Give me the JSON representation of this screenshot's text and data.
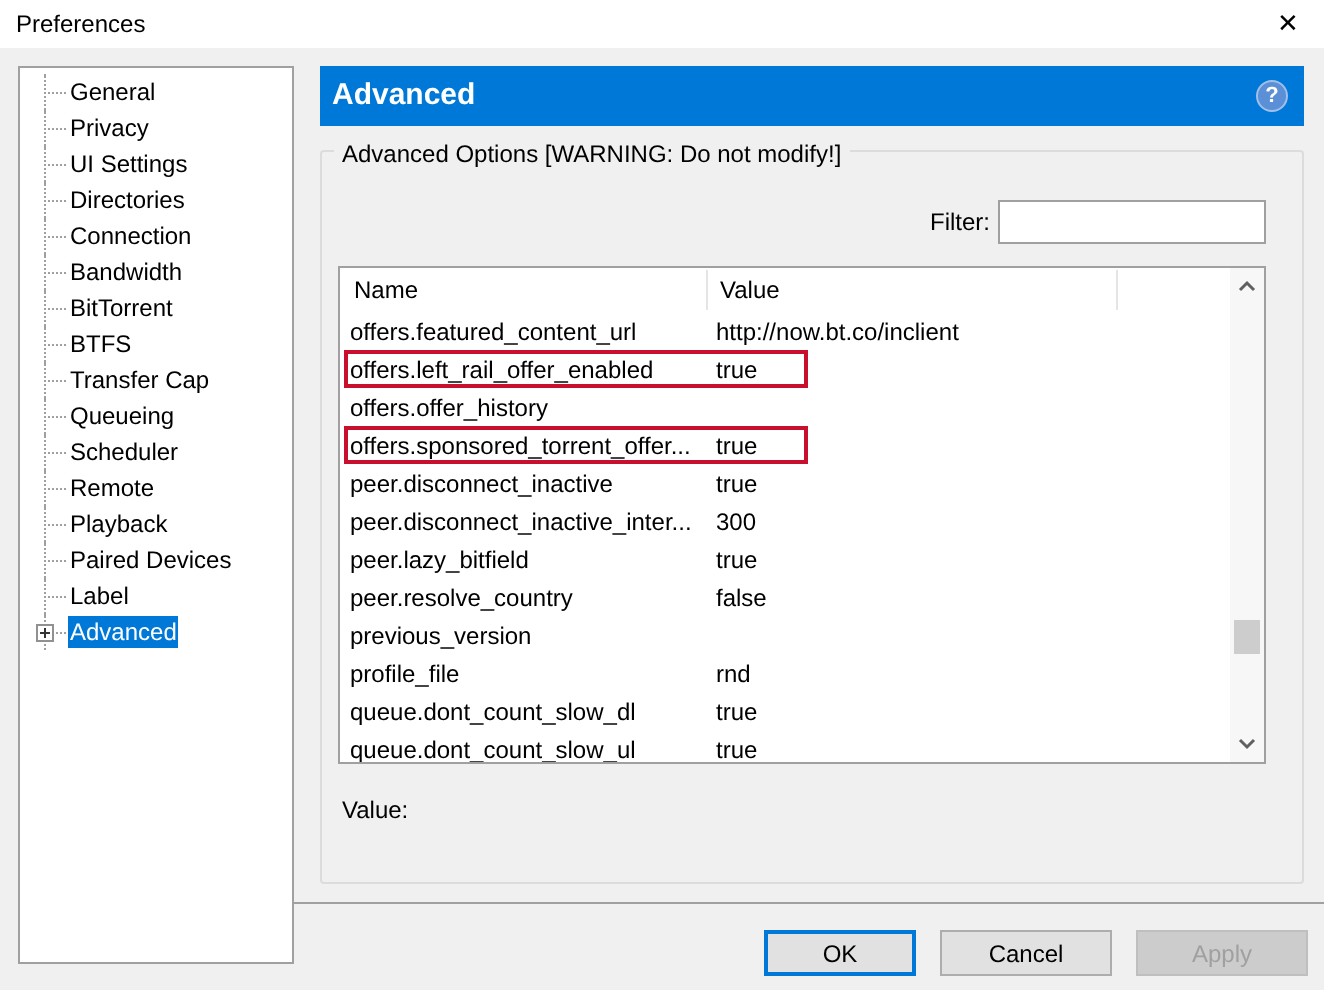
{
  "window": {
    "title": "Preferences",
    "close": "✕"
  },
  "sidebar": {
    "items": [
      {
        "label": "General",
        "selected": false
      },
      {
        "label": "Privacy",
        "selected": false
      },
      {
        "label": "UI Settings",
        "selected": false
      },
      {
        "label": "Directories",
        "selected": false
      },
      {
        "label": "Connection",
        "selected": false
      },
      {
        "label": "Bandwidth",
        "selected": false
      },
      {
        "label": "BitTorrent",
        "selected": false
      },
      {
        "label": "BTFS",
        "selected": false
      },
      {
        "label": "Transfer Cap",
        "selected": false
      },
      {
        "label": "Queueing",
        "selected": false
      },
      {
        "label": "Scheduler",
        "selected": false
      },
      {
        "label": "Remote",
        "selected": false
      },
      {
        "label": "Playback",
        "selected": false
      },
      {
        "label": "Paired Devices",
        "selected": false
      },
      {
        "label": "Label",
        "selected": false
      },
      {
        "label": "Advanced",
        "selected": true,
        "expandable": true
      }
    ]
  },
  "panel": {
    "title": "Advanced",
    "help": "?",
    "group_title": "Advanced Options [WARNING: Do not modify!]",
    "filter_label": "Filter:",
    "value_label": "Value:",
    "table": {
      "columns": [
        "Name",
        "Value"
      ],
      "rows": [
        {
          "name": "offers.featured_content_url",
          "value": "http://now.bt.co/inclient",
          "highlighted": false
        },
        {
          "name": "offers.left_rail_offer_enabled",
          "value": "true",
          "highlighted": true
        },
        {
          "name": "offers.offer_history",
          "value": "",
          "highlighted": false
        },
        {
          "name": "offers.sponsored_torrent_offer...",
          "value": "true",
          "highlighted": true
        },
        {
          "name": "peer.disconnect_inactive",
          "value": "true",
          "highlighted": false
        },
        {
          "name": "peer.disconnect_inactive_inter...",
          "value": "300",
          "highlighted": false
        },
        {
          "name": "peer.lazy_bitfield",
          "value": "true",
          "highlighted": false
        },
        {
          "name": "peer.resolve_country",
          "value": "false",
          "highlighted": false
        },
        {
          "name": "previous_version",
          "value": "",
          "highlighted": false
        },
        {
          "name": "profile_file",
          "value": "rnd",
          "highlighted": false
        },
        {
          "name": "queue.dont_count_slow_dl",
          "value": "true",
          "highlighted": false
        },
        {
          "name": "queue.dont_count_slow_ul",
          "value": "true",
          "highlighted": false
        }
      ]
    }
  },
  "buttons": [
    {
      "label": "OK",
      "kind": "default",
      "disabled": false
    },
    {
      "label": "Cancel",
      "kind": "normal",
      "disabled": false
    },
    {
      "label": "Apply",
      "kind": "normal",
      "disabled": true
    }
  ]
}
